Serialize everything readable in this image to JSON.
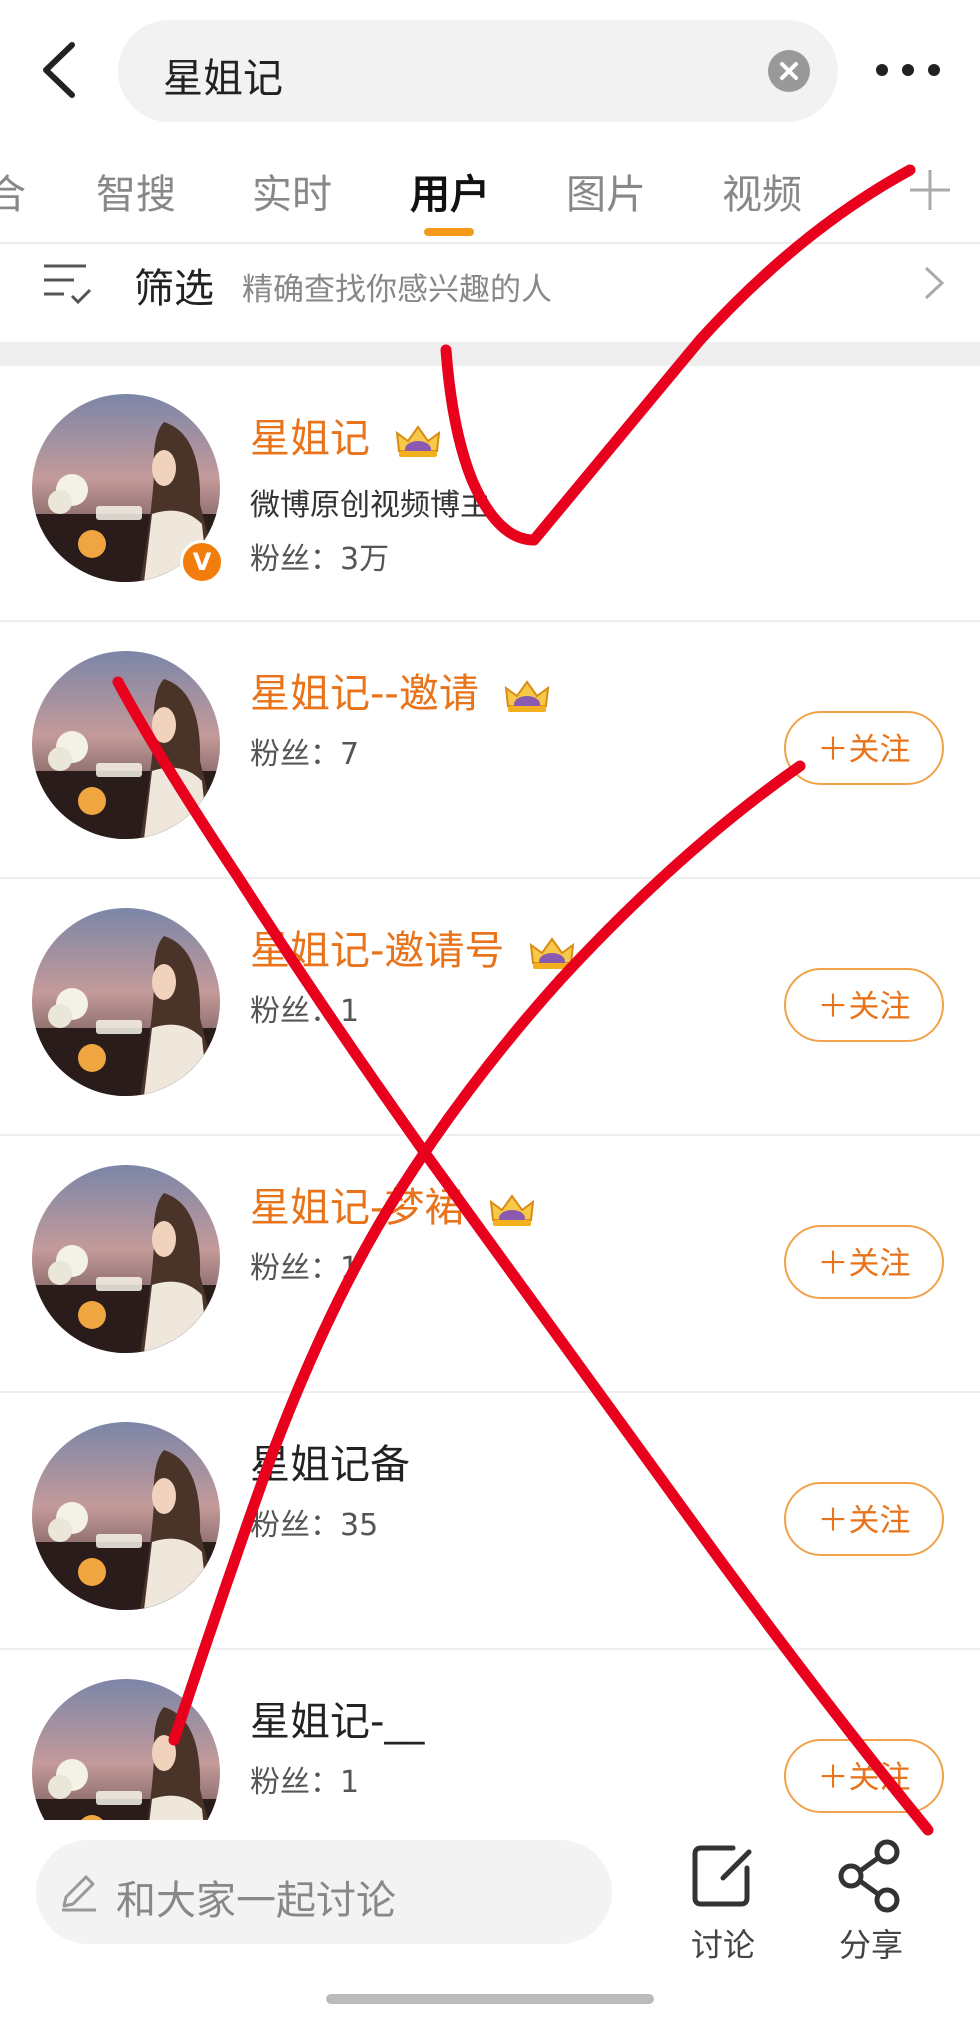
{
  "search": {
    "query": "星姐记"
  },
  "tabs": [
    {
      "label": "合"
    },
    {
      "label": "智搜"
    },
    {
      "label": "实时"
    },
    {
      "label": "用户",
      "active": true
    },
    {
      "label": "图片"
    },
    {
      "label": "视频"
    }
  ],
  "filter": {
    "label": "筛选",
    "description": "精确查找你感兴趣的人"
  },
  "users": [
    {
      "name": "星姐记",
      "name_color": "orange",
      "crown": true,
      "verified": true,
      "bio": "微博原创视频博主",
      "fans": "粉丝：3万",
      "follow": ""
    },
    {
      "name": "星姐记--邀请",
      "name_color": "orange",
      "crown": true,
      "verified": false,
      "bio": "",
      "fans": "粉丝：7",
      "follow": "＋关注"
    },
    {
      "name": "星姐记-邀请号",
      "name_color": "orange",
      "crown": true,
      "verified": false,
      "bio": "",
      "fans": "粉丝：1",
      "follow": "＋关注"
    },
    {
      "name": "星姐记-梦裙",
      "name_color": "orange",
      "crown": true,
      "verified": false,
      "bio": "",
      "fans": "粉丝：1",
      "follow": "＋关注"
    },
    {
      "name": "星姐记备",
      "name_color": "dark",
      "crown": false,
      "verified": false,
      "bio": "",
      "fans": "粉丝：35",
      "follow": "＋关注"
    },
    {
      "name": "星姐记-__",
      "name_color": "dark",
      "crown": false,
      "verified": false,
      "bio": "",
      "fans": "粉丝：1",
      "follow": "＋关注"
    }
  ],
  "bottom": {
    "comment_placeholder": "和大家一起讨论",
    "discuss_label": "讨论",
    "share_label": "分享"
  },
  "colors": {
    "accent": "#e8731a",
    "tab_indicator": "#f39a1c",
    "marker": "#e8001c"
  },
  "icons": [
    "back-icon",
    "clear-icon",
    "more-icon",
    "plus-icon",
    "filter-icon",
    "chevron-right-icon",
    "crown-icon",
    "verified-badge-icon",
    "pencil-icon",
    "discuss-icon",
    "share-icon"
  ]
}
